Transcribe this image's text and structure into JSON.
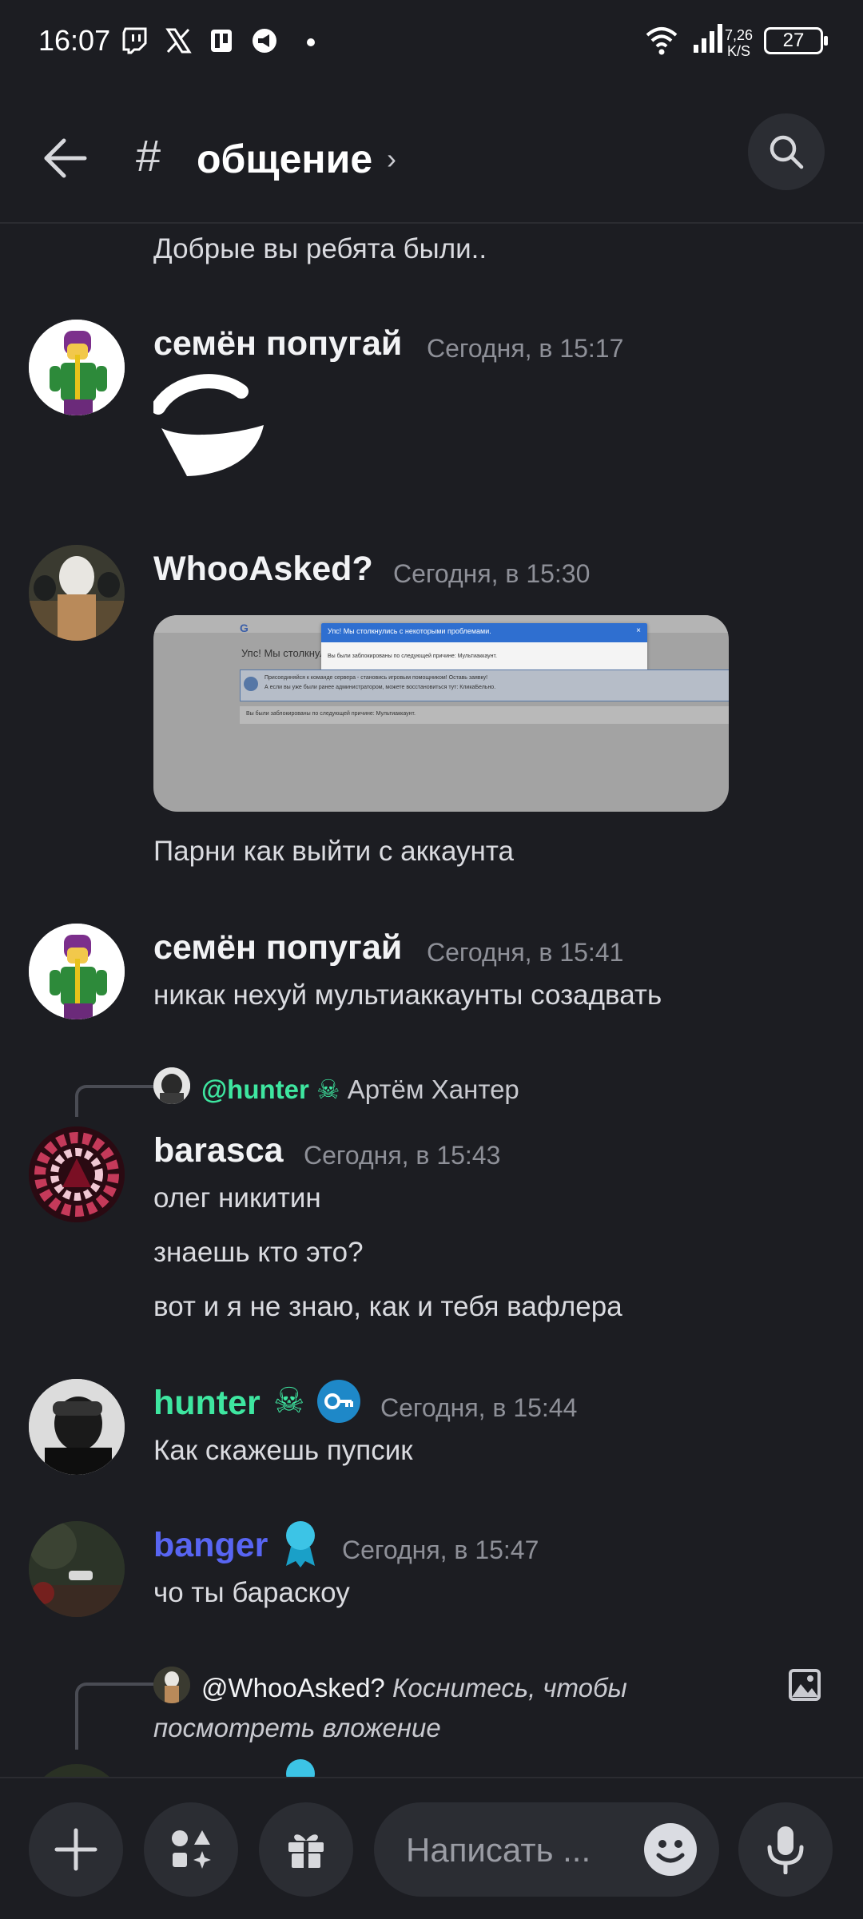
{
  "status_bar": {
    "time": "16:07",
    "net_speed_value": "7,26",
    "net_speed_unit": "K/S",
    "battery": "27"
  },
  "header": {
    "channel_title": "общение"
  },
  "messages": {
    "m0_text": "Добрые вы ребята были..",
    "m1": {
      "author": "семён попугай",
      "timestamp": "Сегодня, в 15:17"
    },
    "m2": {
      "author": "WhooAsked?",
      "timestamp": "Сегодня, в 15:30",
      "image": {
        "dialog_title": "Упс! Мы столкнулись с некоторыми проблемами.",
        "dialog_body": "Вы были заблокированы по следующей причине: Мультиаккаунт.",
        "page_heading": "Упс! Мы столкнул",
        "info_line1": "Присоединяйся к команде сервера - становись игровым помощником! Оставь заявку!",
        "info_line2": "А если вы уже были ранее администратором, можете восстановиться тут: КликаБельно.",
        "ban_line": "Вы были заблокированы по следующей причине: Мультиаккаунт."
      },
      "text": "Парни как выйти с аккаунта"
    },
    "m3": {
      "author": "семён попугай",
      "timestamp": "Сегодня, в 15:41",
      "text": "никак нехуй мультиаккаунты созадвать"
    },
    "m4": {
      "reply_mention": "@hunter",
      "reply_name": "Артём Хантер",
      "author": "barasca",
      "timestamp": "Сегодня, в 15:43",
      "line1": "олег никитин",
      "line2": "знаешь кто это?",
      "line3": "вот и я не знаю, как и тебя вафлера"
    },
    "m5": {
      "author": "hunter",
      "timestamp": "Сегодня, в 15:44",
      "text": "Как скажешь пупсик"
    },
    "m6": {
      "author": "banger",
      "timestamp": "Сегодня, в 15:47",
      "text": "чо ты бараскоу"
    },
    "m7": {
      "reply_mention": "@WhooAsked?",
      "reply_line1": "Коснитесь, чтобы",
      "reply_line2": "посмотреть вложение"
    }
  },
  "composer": {
    "placeholder": "Написать ..."
  },
  "colors": {
    "background": "#1c1d22",
    "hunter_role": "#3ee6a0",
    "banger_role": "#5865f2",
    "muted": "#8e9098"
  },
  "icons": [
    "twitch-icon",
    "x-icon",
    "voting-app-icon",
    "megaphone-icon",
    "wifi-icon",
    "signal-icon",
    "battery-icon",
    "back-arrow-icon",
    "hash-icon",
    "chevron-right-icon",
    "search-icon",
    "skull-role-icon",
    "key-badge-icon",
    "ribbon-badge-icon",
    "image-attachment-icon",
    "plus-icon",
    "apps-icon",
    "gift-icon",
    "emoji-icon",
    "microphone-icon"
  ]
}
